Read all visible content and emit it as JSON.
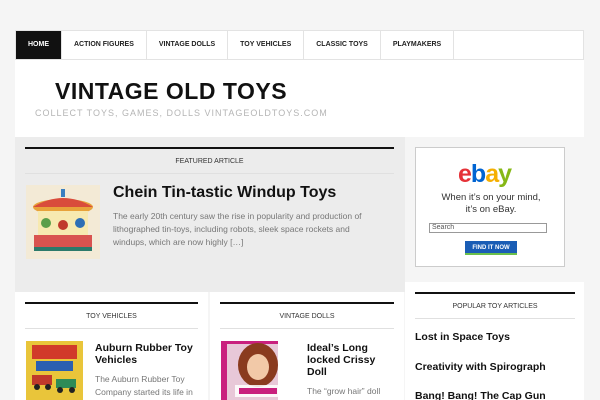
{
  "nav": {
    "items": [
      "HOME",
      "ACTION FIGURES",
      "VINTAGE DOLLS",
      "TOY VEHICLES",
      "CLASSIC TOYS",
      "PLAYMAKERS"
    ]
  },
  "header": {
    "title": "VINTAGE OLD TOYS",
    "description": "COLLECT TOYS, GAMES, DOLLS VINTAGEOLDTOYS.COM"
  },
  "featured": {
    "section_label": "FEATURED ARTICLE",
    "title": "Chein Tin-tastic Windup Toys",
    "excerpt": "The early 20th century saw the rise in popularity and production of lithographed tin-toys, including robots, sleek space rockets and windups, which are now highly […]"
  },
  "ad": {
    "text_line1": "When it’s on your mind,",
    "text_line2": "it’s on eBay.",
    "search_placeholder": "Search",
    "button": "FIND IT NOW",
    "logo_letters": [
      "e",
      "b",
      "a",
      "y"
    ],
    "logo_colors": [
      "#e53238",
      "#0064d2",
      "#f5af02",
      "#86b817"
    ]
  },
  "toy_vehicles": {
    "section_label": "TOY VEHICLES",
    "title_line1": "Auburn Rubber Toy",
    "title_line2": "Vehicles",
    "text_line1": "The Auburn Rubber Toy",
    "text_line2": "Company started its life in"
  },
  "vintage_dolls": {
    "section_label": "VINTAGE DOLLS",
    "title_line1": "Ideal’s Long",
    "title_line2": "locked Crissy",
    "title_line3": "Doll",
    "text_line1": "The “grow hair” doll"
  },
  "popular": {
    "section_label": "POPULAR TOY ARTICLES",
    "items": [
      "Lost in Space Toys",
      "Creativity with Spirograph",
      "Bang! Bang! The Cap Gun"
    ]
  }
}
